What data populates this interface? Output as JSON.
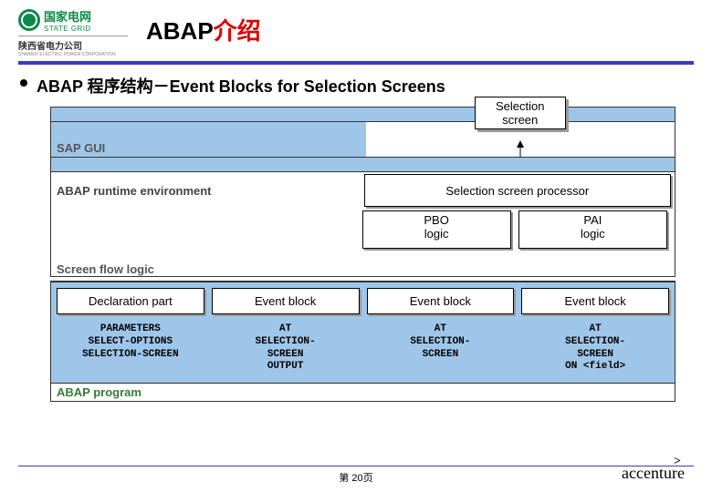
{
  "header": {
    "logo_cn": "国家电网",
    "logo_en": "STATE GRID",
    "logo_sub_cn": "陕西省电力公司",
    "logo_sub_en": "SHAANXI ELECTRIC POWER CORPORATION",
    "title_black": "ABAP",
    "title_red": "介绍"
  },
  "bullet": "ABAP 程序结构－Event Blocks for Selection Screens",
  "diagram": {
    "sel_screen_l1": "Selection",
    "sel_screen_l2": "screen",
    "sap_gui": "SAP GUI",
    "runtime_env": "ABAP runtime environment",
    "sel_proc": "Selection screen processor",
    "pbo_l1": "PBO",
    "pbo_l2": "logic",
    "pai_l1": "PAI",
    "pai_l2": "logic",
    "flow_logic": "Screen flow logic",
    "events": [
      "Declaration part",
      "Event block",
      "Event block",
      "Event block"
    ],
    "code": [
      "PARAMETERS\nSELECT-OPTIONS\nSELECTION-SCREEN",
      "AT\nSELECTION-\nSCREEN\nOUTPUT",
      "AT\nSELECTION-\nSCREEN",
      "AT\nSELECTION-\nSCREEN\nON <field>"
    ],
    "abap_program": "ABAP program"
  },
  "footer": {
    "page": "第 20页",
    "brand": "accenture"
  }
}
